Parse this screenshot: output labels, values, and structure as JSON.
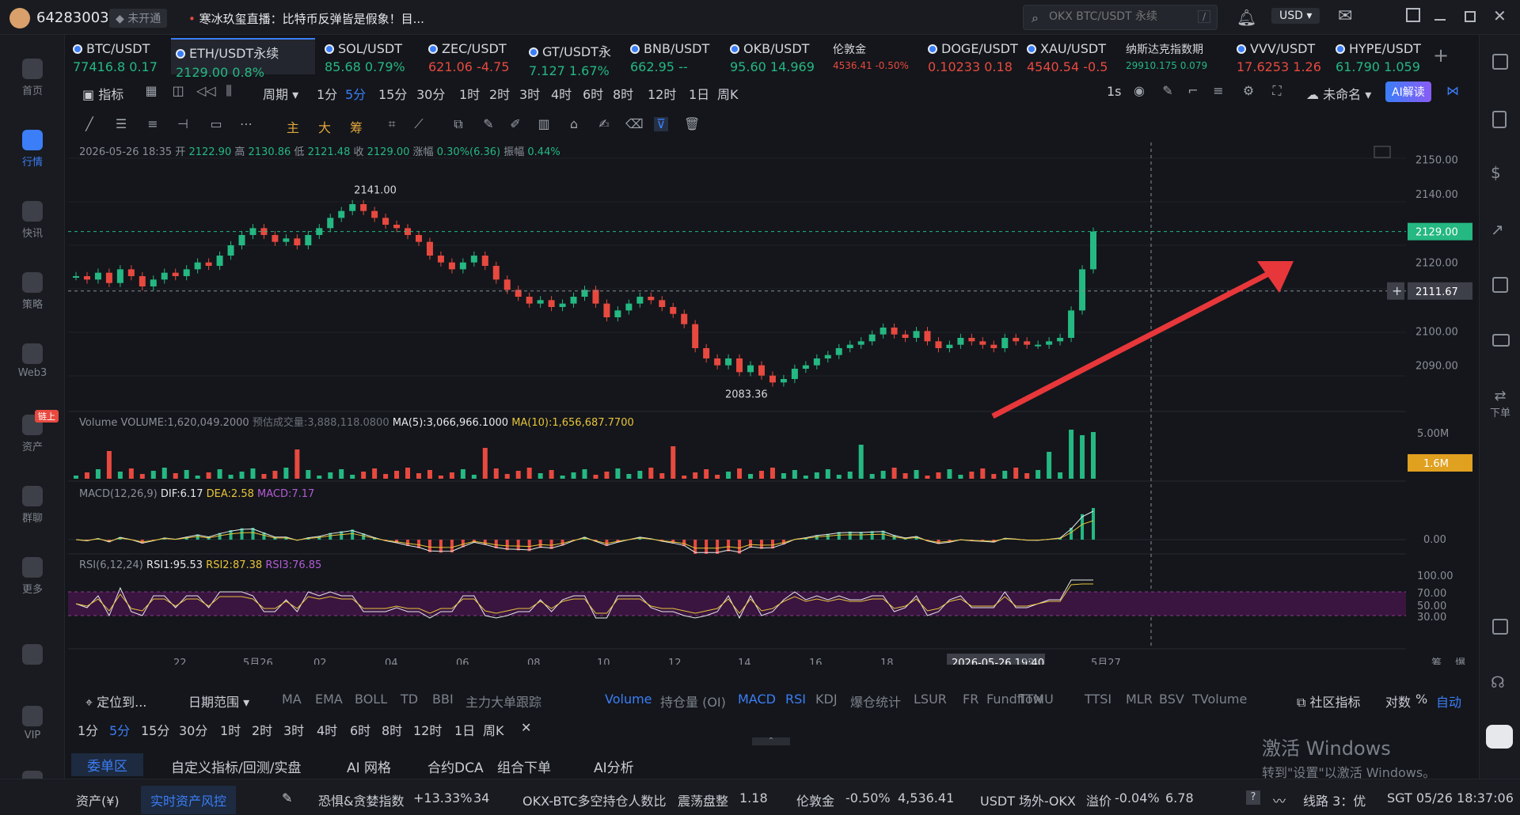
{
  "title_bar": {
    "account_id": "64283003",
    "badge": "未开通",
    "news": "寒冰玖玺直播：比特币反弹皆是假象！目...",
    "search_placeholder": "OKX BTC/USDT 永续",
    "currency": "USD"
  },
  "left_nav": [
    {
      "label": "首页",
      "icon": "home-icon"
    },
    {
      "label": "行情",
      "icon": "market-icon",
      "active": true
    },
    {
      "label": "快讯",
      "icon": "news-icon"
    },
    {
      "label": "策略",
      "icon": "robot-icon"
    },
    {
      "label": "Web3",
      "icon": "web3-icon"
    },
    {
      "label": "资产",
      "icon": "wallet-icon",
      "badge": "链上"
    },
    {
      "label": "群聊",
      "icon": "chat-icon"
    },
    {
      "label": "更多",
      "icon": "grid-icon"
    },
    {
      "label": "",
      "icon": "phone-icon"
    },
    {
      "label": "VIP",
      "icon": "vip-icon"
    },
    {
      "label": "",
      "icon": "settings-icon"
    }
  ],
  "tickers": [
    {
      "name": "BTC/USDT",
      "price": "77416.8",
      "change": "0.17",
      "dir": "up"
    },
    {
      "name": "ETH/USDT永续",
      "price": "2129.00",
      "change": "0.8%",
      "dir": "up",
      "active": true
    },
    {
      "name": "SOL/USDT",
      "price": "85.68",
      "change": "0.79%",
      "dir": "up"
    },
    {
      "name": "ZEC/USDT",
      "price": "621.06",
      "change": "-4.75",
      "dir": "dn"
    },
    {
      "name": "GT/USDT永",
      "price": "7.127",
      "change": "1.67%",
      "dir": "up"
    },
    {
      "name": "BNB/USDT",
      "price": "662.95",
      "change": "--",
      "dir": "up"
    },
    {
      "name": "OKB/USDT",
      "price": "95.60",
      "change": "14.969",
      "dir": "up"
    },
    {
      "name": "伦敦金",
      "price": "4536.41",
      "change": "-0.50%",
      "dir": "dn",
      "small": true
    },
    {
      "name": "DOGE/USDT",
      "price": "0.10233",
      "change": "0.18",
      "dir": "dn"
    },
    {
      "name": "XAU/USDT",
      "price": "4540.54",
      "change": "-0.5",
      "dir": "dn"
    },
    {
      "name": "纳斯达克指数期",
      "price": "29910.175",
      "change": "0.079",
      "dir": "up",
      "small": true
    },
    {
      "name": "VVV/USDT",
      "price": "17.6253",
      "change": "1.26",
      "dir": "dn"
    },
    {
      "name": "HYPE/USDT",
      "price": "61.790",
      "change": "1.059",
      "dir": "up"
    }
  ],
  "period_bar": {
    "indicator": "指标",
    "period": "周期",
    "periods": [
      "1分",
      "5分",
      "15分",
      "30分",
      "1时",
      "2时",
      "3时",
      "4时",
      "6时",
      "8时",
      "12时",
      "1日",
      "周K"
    ],
    "active": "5分",
    "interval": "1s",
    "unnamed": "未命名",
    "ai_button": "AI解读"
  },
  "draw_bar": {
    "labels": [
      "主",
      "大",
      "筹"
    ]
  },
  "ohlc": {
    "date": "2026-05-26 18:35",
    "open_label": "开",
    "open": "2122.90",
    "high_label": "高",
    "high": "2130.86",
    "low_label": "低",
    "low": "2121.48",
    "close_label": "收",
    "close": "2129.00",
    "chg_label": "涨幅",
    "chg": "0.30%(6.36)",
    "amp_label": "振幅",
    "amp": "0.44%"
  },
  "price_axis": [
    "2150.00",
    "2140.00",
    "2129.00",
    "2120.00",
    "2111.67",
    "2100.00",
    "2090.00"
  ],
  "annotations": {
    "high": "2141.00",
    "low": "2083.36"
  },
  "volume": {
    "label": "Volume",
    "vol_text": "VOLUME:1,620,049.2000",
    "est_text": "预估成交量:3,888,118.0800",
    "ma5_text": "MA(5):3,066,966.1000",
    "ma10_text": "MA(10):1,656,687.7700",
    "axis_top": "5.00M",
    "axis_tag": "1.6M"
  },
  "macd": {
    "label": "MACD(12,26,9)",
    "dif": "DIF:6.17",
    "dea": "DEA:2.58",
    "macd": "MACD:7.17",
    "axis": "0.00"
  },
  "rsi": {
    "label": "RSI(6,12,24)",
    "rsi1": "RSI1:95.53",
    "rsi2": "RSI2:87.38",
    "rsi3": "RSI3:76.85",
    "axis": [
      "100.00",
      "70.00",
      "50.00",
      "30.00"
    ]
  },
  "time_axis": [
    "22",
    "5月26",
    "02",
    "04",
    "06",
    "08",
    "10",
    "12",
    "14",
    "16",
    "18",
    "2026-05-26 19:40",
    "22",
    "5月27"
  ],
  "time_axis_right": [
    "筹",
    "爆"
  ],
  "indicator_row": {
    "locate": "定位到...",
    "date_range": "日期范围",
    "items": [
      "MA",
      "EMA",
      "BOLL",
      "TD",
      "BBI",
      "主力大单跟踪"
    ],
    "sub_items": [
      "Volume",
      "持仓量 (OI)",
      "MACD",
      "RSI",
      "KDJ",
      "爆仓统计",
      "LSUR",
      "FR",
      "Fundflow",
      "TTMU",
      "TTSI",
      "MLR",
      "BSV",
      "TVolume"
    ],
    "community": "社区指标",
    "log": "对数",
    "pct": "%",
    "auto": "自动"
  },
  "period_row": [
    "1分",
    "5分",
    "15分",
    "30分",
    "1时",
    "2时",
    "3时",
    "4时",
    "6时",
    "8时",
    "12时",
    "1日",
    "周K"
  ],
  "bottom_tabs": [
    "委单区",
    "自定义指标/回测/实盘",
    "AI 网格",
    "合约DCA",
    "组合下单",
    "AI分析"
  ],
  "status_bar": {
    "assets": "资产(¥)",
    "risk": "实时资产风控",
    "fear_label": "恐惧&贪婪指数",
    "fear_chg": "+13.33%",
    "fear_val": "34",
    "okx_label": "OKX-BTC多空持仓人数比",
    "okx_state": "震荡盘整",
    "okx_val": "1.18",
    "gold_label": "伦敦金",
    "gold_chg": "-0.50%",
    "gold_val": "4,536.41",
    "usdt_label": "USDT 场外-OKX",
    "premium_label": "溢价",
    "premium_chg": "-0.04%",
    "premium_val": "6.78",
    "line": "线路 3：优",
    "time": "SGT 05/26 18:37:06"
  },
  "watermark": {
    "line1": "激活 Windows",
    "line2": "转到\"设置\"以激活 Windows。"
  },
  "right_nav": {
    "order_label": "下单"
  },
  "chart_data": {
    "type": "candlestick",
    "last_price": 2129.0,
    "crosshair_price": 2111.67,
    "high": 2141.0,
    "low": 2083.36,
    "ylim": [
      2080,
      2155
    ],
    "closes": [
      2116,
      2115,
      2117,
      2114,
      2118,
      2116,
      2113,
      2115,
      2117,
      2116,
      2118,
      2120,
      2119,
      2122,
      2125,
      2128,
      2130,
      2128,
      2126,
      2127,
      2125,
      2128,
      2130,
      2133,
      2135,
      2137,
      2135,
      2133,
      2131,
      2130,
      2128,
      2126,
      2122,
      2120,
      2118,
      2120,
      2122,
      2119,
      2115,
      2112,
      2110,
      2108,
      2109,
      2107,
      2108,
      2110,
      2112,
      2108,
      2104,
      2106,
      2108,
      2110,
      2109,
      2107,
      2105,
      2102,
      2095,
      2092,
      2090,
      2092,
      2088,
      2090,
      2087,
      2085,
      2086,
      2089,
      2090,
      2092,
      2093,
      2095,
      2096,
      2097,
      2099,
      2101,
      2099,
      2098,
      2100,
      2097,
      2095,
      2096,
      2098,
      2097,
      2096,
      2095,
      2098,
      2097,
      2096,
      2096,
      2097,
      2098,
      2106,
      2118,
      2129
    ]
  }
}
